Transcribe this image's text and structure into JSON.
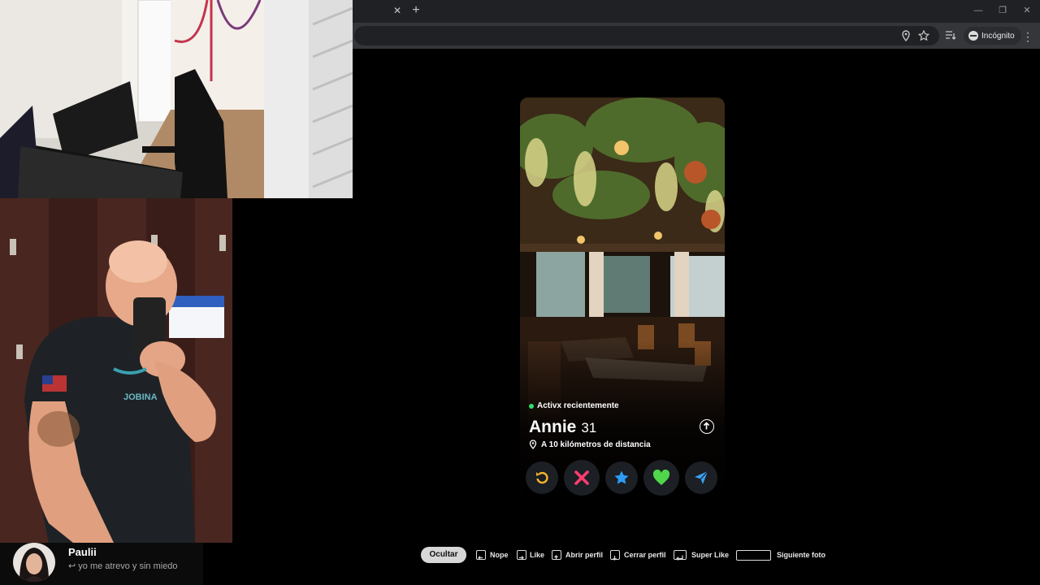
{
  "browser": {
    "incognito_label": "Incógnito"
  },
  "card": {
    "status": "Activx recientemente",
    "name": "Annie",
    "age": "31",
    "distance": "A 10 kilómetros de distancia"
  },
  "hints": {
    "hide": "Ocultar",
    "nope": "Nope",
    "like": "Like",
    "open_profile": "Abrir perfil",
    "close_profile": "Cerrar perfil",
    "super_like": "Super Like",
    "next_photo": "Siguiente foto"
  },
  "chat": {
    "username": "Paulii",
    "message": "↩ yo me atrevo y sin miedo"
  },
  "streamer_shirt_text": "JOBINA",
  "colors": {
    "rewind": "#f5b52a",
    "nope": "#fe3c72",
    "superlike": "#2d9cf5",
    "like": "#4fd64a",
    "boost": "#3aa0f0",
    "active_dot": "#2ee06e"
  },
  "icons": [
    "close-icon",
    "plus-icon",
    "location-icon",
    "star-icon",
    "reading-list-icon",
    "incognito-icon",
    "menu-icon",
    "rewind-icon",
    "nope-icon",
    "superlike-icon",
    "like-icon",
    "boost-icon",
    "arrow-up-icon",
    "map-pin-icon",
    "arrow-left-key-icon",
    "arrow-right-key-icon",
    "arrow-up-key-icon",
    "arrow-down-key-icon",
    "enter-key-icon",
    "space-key-icon"
  ]
}
